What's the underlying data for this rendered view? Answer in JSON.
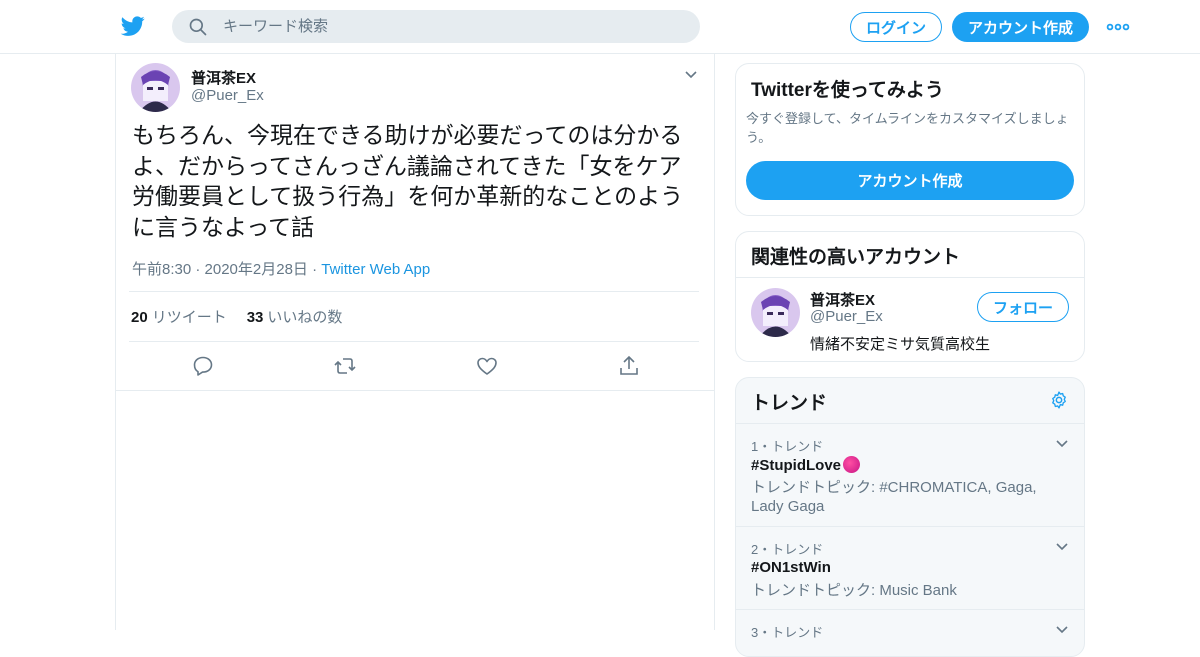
{
  "header": {
    "search_placeholder": "キーワード検索",
    "login_label": "ログイン",
    "signup_label": "アカウント作成"
  },
  "tweet": {
    "author_name": "普洱茶EX",
    "author_handle": "@Puer_Ex",
    "text": "もちろん、今現在できる助けが必要だってのは分かるよ、だからってさんっざん議論されてきた「女をケア労働要員として扱う行為」を何か革新的なことのように言うなよって話",
    "timestamp": "午前8:30 · 2020年2月28日",
    "separator": " · ",
    "source_app": "Twitter Web App",
    "retweet_count": "20",
    "retweet_label": "リツイート",
    "like_count": "33",
    "like_label": "いいねの数"
  },
  "sidebar": {
    "signup_card": {
      "title": "Twitterを使ってみよう",
      "description": "今すぐ登録して、タイムラインをカスタマイズしましょう。",
      "button_label": "アカウント作成"
    },
    "related": {
      "title": "関連性の高いアカウント",
      "name": "普洱茶EX",
      "handle": "@Puer_Ex",
      "bio": "情緒不安定ミサ気質高校生",
      "follow_label": "フォロー"
    },
    "trends": {
      "title": "トレンド",
      "items": [
        {
          "rank": "1・トレンド",
          "tag": "#StupidLove",
          "topic": "トレンドトピック: #CHROMATICA, Gaga, Lady Gaga"
        },
        {
          "rank": "2・トレンド",
          "tag": "#ON1stWin",
          "topic": "トレンドトピック: Music Bank"
        },
        {
          "rank": "3・トレンド",
          "tag": "",
          "topic": ""
        }
      ]
    }
  },
  "colors": {
    "brand": "#1da1f2",
    "text_primary": "#14171a",
    "text_secondary": "#657786",
    "border": "#e6ecf0"
  },
  "icons": [
    "twitter-logo-icon",
    "search-icon",
    "more-icon",
    "chevron-down-icon",
    "reply-icon",
    "retweet-icon",
    "like-icon",
    "share-icon",
    "gear-icon"
  ]
}
